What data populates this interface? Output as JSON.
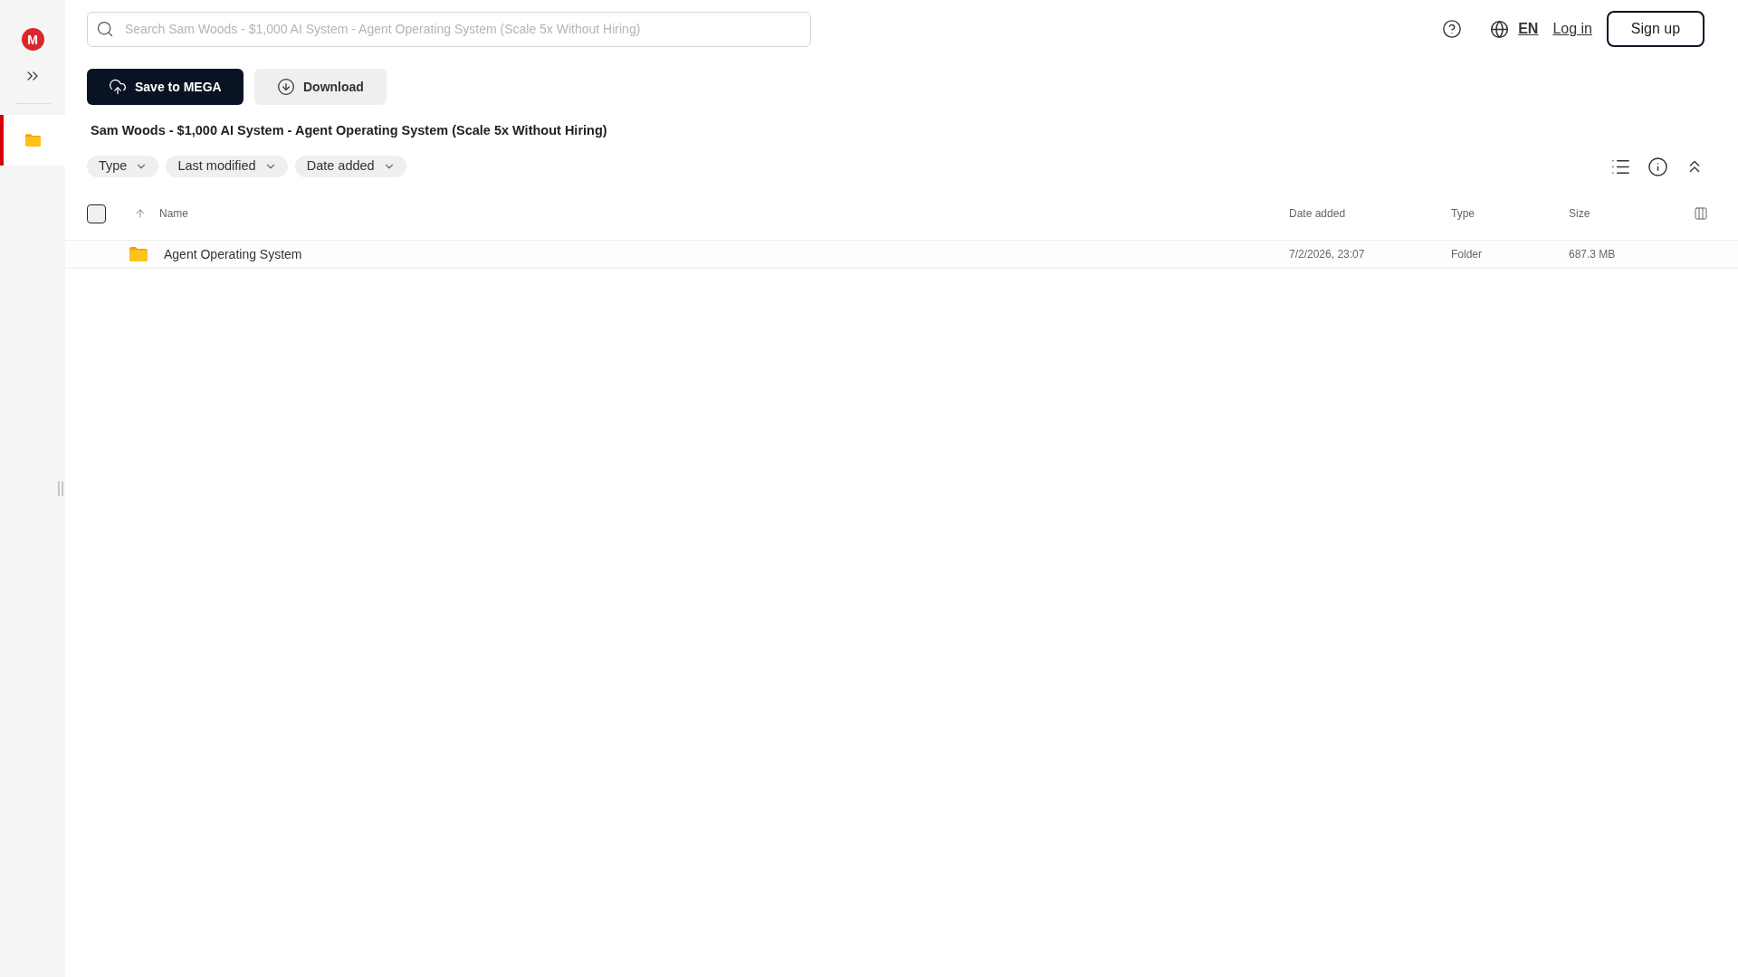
{
  "sidebar": {
    "logo": {
      "text": "M"
    },
    "items": [
      {
        "selected": true
      }
    ]
  },
  "search": {
    "placeholder": "Search Sam Woods - $1,000 AI System - Agent Operating System (Scale 5x Without Hiring)"
  },
  "header": {
    "language": "EN",
    "login": "Log in",
    "signup": "Sign up"
  },
  "actions": [
    {
      "label": "Save to MEGA",
      "kind": "primary"
    },
    {
      "label": "Download",
      "kind": "secondary"
    }
  ],
  "folder_title": "Sam Woods - $1,000 AI System - Agent Operating System (Scale 5x Without Hiring)",
  "filters": [
    "Type",
    "Last modified",
    "Date added"
  ],
  "table": {
    "select_all": {
      "checked": false
    },
    "columns": [
      {
        "label": "Name",
        "sorted": true
      },
      {
        "label": "Date added",
        "sorted": false
      },
      {
        "label": "Type",
        "sorted": false
      },
      {
        "label": "Size",
        "sorted": false
      }
    ],
    "rows": [
      {
        "name": "Agent Operating System",
        "date_added": "7/2/2026, 23:07",
        "type": "Folder",
        "size": "687.3 MB"
      }
    ]
  }
}
